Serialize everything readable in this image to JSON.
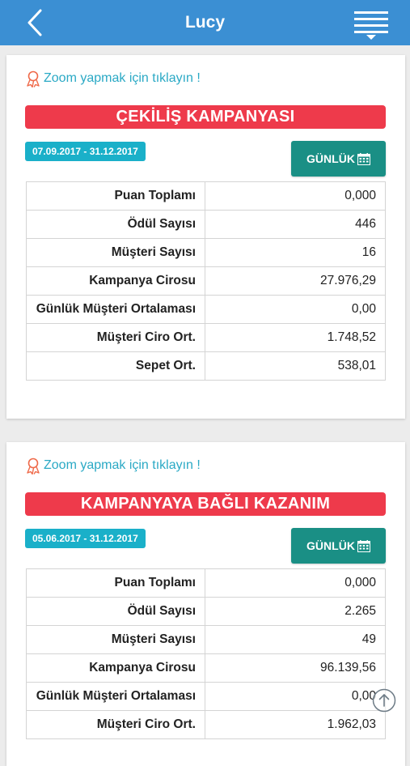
{
  "nav": {
    "title": "Lucy"
  },
  "icons": {
    "back": "chevron-left-icon",
    "menu": "hamburger-menu-icon",
    "zoom": "award-ribbon-icon",
    "calendar": "calendar-icon",
    "scroll_top": "arrow-up-circle-icon"
  },
  "colors": {
    "nav_bar": "#3b8fd3",
    "banner": "#ee3a4b",
    "date_badge": "#1ab0c9",
    "period_button": "#1a8f85",
    "zoom_link": "#2aa9c5"
  },
  "cards": [
    {
      "zoom_text": "Zoom yapmak için tıklayın !",
      "campaign_title": "ÇEKİLİŞ KAMPANYASI",
      "date_range": "07.09.2017 - 31.12.2017",
      "period_label": "GÜNLÜK",
      "rows": [
        {
          "label": "Puan Toplamı",
          "value": "0,000"
        },
        {
          "label": "Ödül Sayısı",
          "value": "446"
        },
        {
          "label": "Müşteri Sayısı",
          "value": "16"
        },
        {
          "label": "Kampanya Cirosu",
          "value": "27.976,29"
        },
        {
          "label": "Günlük Müşteri Ortalaması",
          "value": "0,00"
        },
        {
          "label": "Müşteri Ciro Ort.",
          "value": "1.748,52"
        },
        {
          "label": "Sepet Ort.",
          "value": "538,01"
        }
      ]
    },
    {
      "zoom_text": "Zoom yapmak için tıklayın !",
      "campaign_title": "KAMPANYAYA BAĞLI KAZANIM",
      "date_range": "05.06.2017 - 31.12.2017",
      "period_label": "GÜNLÜK",
      "rows": [
        {
          "label": "Puan Toplamı",
          "value": "0,000"
        },
        {
          "label": "Ödül Sayısı",
          "value": "2.265"
        },
        {
          "label": "Müşteri Sayısı",
          "value": "49"
        },
        {
          "label": "Kampanya Cirosu",
          "value": "96.139,56"
        },
        {
          "label": "Günlük Müşteri Ortalaması",
          "value": "0,00"
        },
        {
          "label": "Müşteri Ciro Ort.",
          "value": "1.962,03"
        }
      ]
    }
  ]
}
